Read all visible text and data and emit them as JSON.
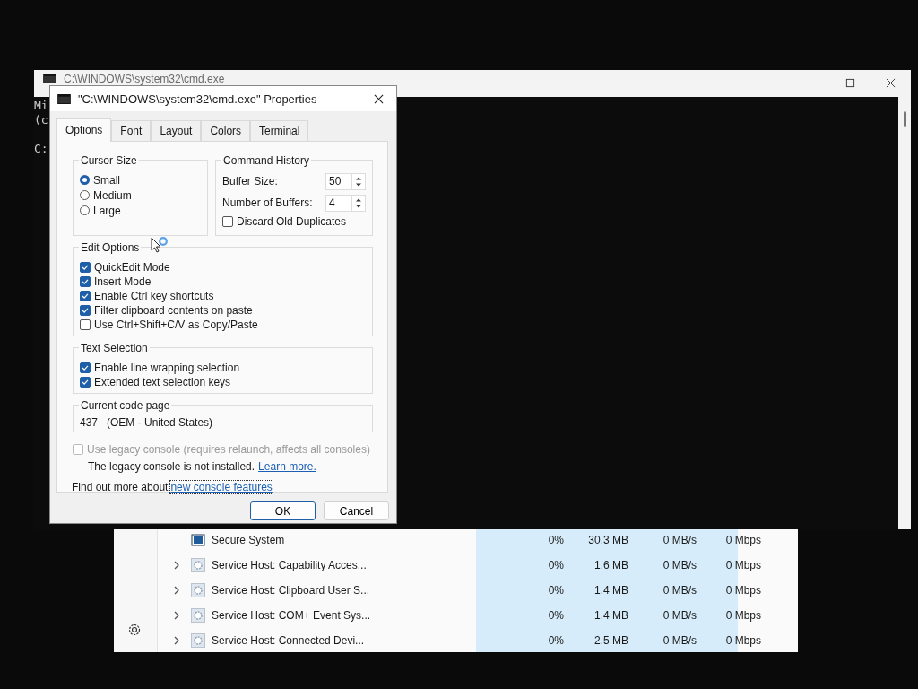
{
  "task_manager": {
    "rows": [
      {
        "kind": "system",
        "name": "Secure System",
        "expandable": false,
        "cpu": "0%",
        "memory": "30.3 MB",
        "disk": "0 MB/s",
        "network": "0 Mbps"
      },
      {
        "kind": "service",
        "name": "Service Host: Capability Acces...",
        "expandable": true,
        "cpu": "0%",
        "memory": "1.6 MB",
        "disk": "0 MB/s",
        "network": "0 Mbps"
      },
      {
        "kind": "service",
        "name": "Service Host: Clipboard User S...",
        "expandable": true,
        "cpu": "0%",
        "memory": "1.4 MB",
        "disk": "0 MB/s",
        "network": "0 Mbps"
      },
      {
        "kind": "service",
        "name": "Service Host: COM+ Event Sys...",
        "expandable": true,
        "cpu": "0%",
        "memory": "1.4 MB",
        "disk": "0 MB/s",
        "network": "0 Mbps"
      },
      {
        "kind": "service",
        "name": "Service Host: Connected Devi...",
        "expandable": true,
        "cpu": "0%",
        "memory": "2.5 MB",
        "disk": "0 MB/s",
        "network": "0 Mbps"
      }
    ]
  },
  "console": {
    "title": "C:\\WINDOWS\\system32\\cmd.exe",
    "lines": [
      "Mi",
      "(c",
      "C:"
    ]
  },
  "dialog": {
    "title": "\"C:\\WINDOWS\\system32\\cmd.exe\" Properties",
    "tabs": [
      {
        "label": "Options",
        "selected": true
      },
      {
        "label": "Font",
        "selected": false
      },
      {
        "label": "Layout",
        "selected": false
      },
      {
        "label": "Colors",
        "selected": false
      },
      {
        "label": "Terminal",
        "selected": false
      }
    ],
    "cursor_size": {
      "title": "Cursor Size",
      "options": [
        {
          "label": "Small",
          "selected": true
        },
        {
          "label": "Medium",
          "selected": false
        },
        {
          "label": "Large",
          "selected": false
        }
      ]
    },
    "command_history": {
      "title": "Command History",
      "fields": [
        {
          "label": "Buffer Size:",
          "value": "50"
        },
        {
          "label": "Number of Buffers:",
          "value": "4"
        }
      ],
      "discard": {
        "label": "Discard Old Duplicates",
        "checked": false
      }
    },
    "edit_options": {
      "title": "Edit Options",
      "items": [
        {
          "label": "QuickEdit Mode",
          "checked": true
        },
        {
          "label": "Insert Mode",
          "checked": true
        },
        {
          "label": "Enable Ctrl key shortcuts",
          "checked": true
        },
        {
          "label": "Filter clipboard contents on paste",
          "checked": true
        },
        {
          "label": "Use Ctrl+Shift+C/V as Copy/Paste",
          "checked": false
        }
      ]
    },
    "text_selection": {
      "title": "Text Selection",
      "items": [
        {
          "label": "Enable line wrapping selection",
          "checked": true
        },
        {
          "label": "Extended text selection keys",
          "checked": true
        }
      ]
    },
    "code_page": {
      "title": "Current code page",
      "value": "437   (OEM - United States)"
    },
    "legacy": {
      "label": "Use legacy console (requires relaunch, affects all consoles)",
      "checked": false,
      "disabled": true,
      "note": "The legacy console is not installed.",
      "link": "Learn more."
    },
    "footer": {
      "text": "Find out more about",
      "link": "new console features"
    },
    "buttons": [
      {
        "label": "OK",
        "default": true
      },
      {
        "label": "Cancel",
        "default": false
      }
    ]
  }
}
